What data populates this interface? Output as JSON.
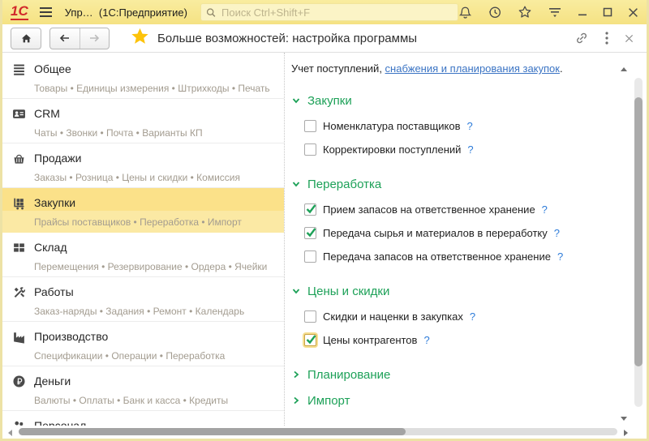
{
  "topbar": {
    "logo": "1С",
    "tab_title": "Упр…",
    "app_label": "(1С:Предприятие)",
    "search_placeholder": "Поиск Ctrl+Shift+F"
  },
  "toolbar": {
    "page_title": "Больше возможностей: настройка программы"
  },
  "sidebar": {
    "items": [
      {
        "label": "Общее",
        "sublabel": "Товары • Единицы измерения • Штрихкоды • Печать",
        "active": false
      },
      {
        "label": "CRM",
        "sublabel": "Чаты • Звонки • Почта • Варианты КП",
        "active": false
      },
      {
        "label": "Продажи",
        "sublabel": "Заказы • Розница • Цены и скидки • Комиссия",
        "active": false
      },
      {
        "label": "Закупки",
        "sublabel": "Прайсы поставщиков • Переработка • Импорт",
        "active": true
      },
      {
        "label": "Склад",
        "sublabel": "Перемещения • Резервирование • Ордера • Ячейки",
        "active": false
      },
      {
        "label": "Работы",
        "sublabel": "Заказ-наряды • Задания • Ремонт • Календарь",
        "active": false
      },
      {
        "label": "Производство",
        "sublabel": "Спецификации • Операции • Переработка",
        "active": false
      },
      {
        "label": "Деньги",
        "sublabel": "Валюты • Оплаты • Банк и касса • Кредиты",
        "active": false
      },
      {
        "label": "Персонал",
        "sublabel": "",
        "active": false
      }
    ]
  },
  "content": {
    "intro_prefix": "Учет поступлений, ",
    "intro_link": "снабжения и планирования закупок",
    "intro_suffix": ".",
    "help_symbol": "?",
    "sections": [
      {
        "title": "Закупки",
        "collapsed": false,
        "items": [
          {
            "label": "Номенклатура поставщиков",
            "checked": false,
            "focused": false
          },
          {
            "label": "Корректировки поступлений",
            "checked": false,
            "focused": false
          }
        ]
      },
      {
        "title": "Переработка",
        "collapsed": false,
        "items": [
          {
            "label": "Прием запасов на ответственное хранение",
            "checked": true,
            "focused": false
          },
          {
            "label": "Передача сырья и материалов в переработку",
            "checked": true,
            "focused": false
          },
          {
            "label": "Передача запасов на ответственное хранение",
            "checked": false,
            "focused": false
          }
        ]
      },
      {
        "title": "Цены и скидки",
        "collapsed": false,
        "items": [
          {
            "label": "Скидки и наценки в закупках",
            "checked": false,
            "focused": false
          },
          {
            "label": "Цены контрагентов",
            "checked": true,
            "focused": true
          }
        ]
      },
      {
        "title": "Планирование",
        "collapsed": true,
        "items": []
      },
      {
        "title": "Импорт",
        "collapsed": true,
        "items": []
      }
    ]
  },
  "colors": {
    "brand_yellow": "#f7e68f",
    "highlight_yellow": "#fbe189",
    "section_green": "#1da158",
    "link_blue": "#3b74c4",
    "help_blue": "#2e7cd9",
    "logo_red": "#d1292b",
    "favorite_star": "#fdc30a"
  }
}
